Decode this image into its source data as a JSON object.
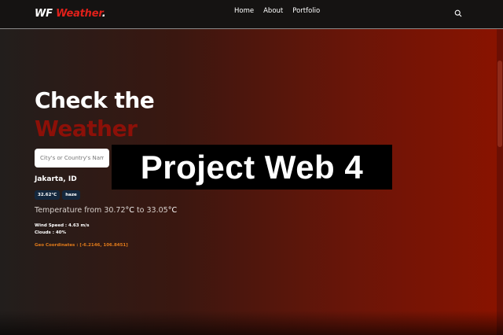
{
  "brand": {
    "prefix": "WF",
    "accent": "Weather",
    "suffix": "."
  },
  "nav": {
    "links": [
      "Home",
      "About",
      "Portfolio"
    ]
  },
  "hero": {
    "line1": "Check the",
    "line2": "Weather"
  },
  "search": {
    "placeholder": "City's or Country's Name"
  },
  "overlay": {
    "text": "Project Web 4"
  },
  "weather": {
    "location": "Jakarta, ID",
    "badges": [
      "32.62°C",
      "haze"
    ],
    "temp_prefix": "Temperature from 30.72",
    "temp_c1": "°C",
    "temp_mid": " to 33.05",
    "temp_c2": "°C",
    "wind": "Wind Speed : 4.63 m/s",
    "clouds": "Clouds : 40%",
    "geo": "Geo Coordinates : [-6.2146, 106.8451]"
  },
  "colors": {
    "accent": "#e0201a",
    "hero_accent": "#8c1008",
    "badge_bg": "#14283e",
    "geo": "#e07a1a"
  }
}
